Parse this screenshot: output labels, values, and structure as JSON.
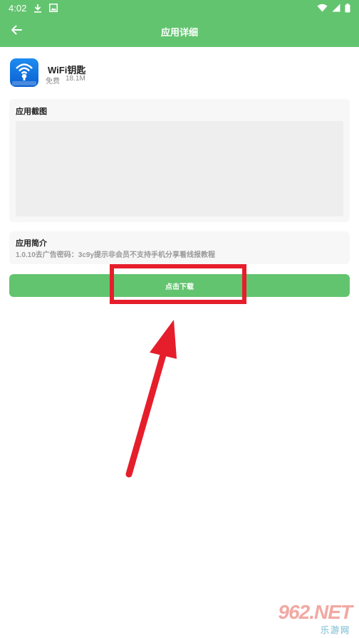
{
  "status_bar": {
    "time": "4:02",
    "icons": [
      "download-icon",
      "image-icon",
      "wifi-icon",
      "signal-icon",
      "battery-icon"
    ]
  },
  "app_bar": {
    "title": "应用详细",
    "back_icon": "arrow-left-icon"
  },
  "app": {
    "name": "WiFi钥匙",
    "price": "免费",
    "size": "18.1M",
    "icon": "wifi-key-app-icon",
    "icon_caption": "WiFi钥匙"
  },
  "screenshots_section": {
    "title": "应用截图"
  },
  "intro_section": {
    "title": "应用简介",
    "text": "1.0.10去广告密码：3c9y提示非会员不支持手机分享看线报教程"
  },
  "download_button": {
    "label": "点击下载"
  },
  "annotation": {
    "color": "#e61e2b"
  },
  "watermark": {
    "logo": "962.NET",
    "subtitle": "乐游网"
  },
  "colors": {
    "primary": "#63c46f",
    "card_bg": "#f7f7f7",
    "text_dark": "#222222",
    "text_muted": "#888888"
  }
}
